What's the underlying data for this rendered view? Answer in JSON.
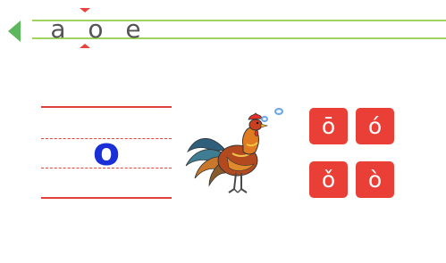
{
  "nav": {
    "letters": [
      "a",
      "o",
      "e"
    ],
    "selected_index": 1,
    "line_color": "#9ed45f",
    "back_color": "#5cb85c"
  },
  "board": {
    "letter": "o",
    "letter_color": "#1a2fd6",
    "line_color": "#e2403a"
  },
  "tones": {
    "buttons": [
      "ō",
      "ó",
      "ǒ",
      "ò"
    ],
    "color": "#ea3f37"
  }
}
